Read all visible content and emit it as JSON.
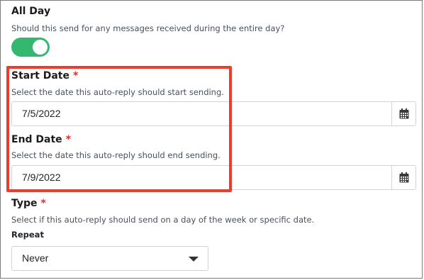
{
  "all_day": {
    "label": "All Day",
    "help": "Should this send for any messages received during the entire day?",
    "toggle_on": true
  },
  "start_date": {
    "label": "Start Date",
    "required_mark": "*",
    "help": "Select the date this auto-reply should start sending.",
    "value": "7/5/2022"
  },
  "end_date": {
    "label": "End Date",
    "required_mark": "*",
    "help": "Select the date this auto-reply should end sending.",
    "value": "7/9/2022"
  },
  "type": {
    "label": "Type",
    "required_mark": "*",
    "help": "Select if this auto-reply should send on a day of the week or specific date."
  },
  "repeat": {
    "label": "Repeat",
    "selected": "Never"
  },
  "colors": {
    "toggle_on": "#34b870",
    "required": "#d32f2f",
    "highlight": "#ee3b2b"
  },
  "icons": {
    "calendar": "calendar-icon",
    "dropdown": "chevron-down-icon"
  }
}
